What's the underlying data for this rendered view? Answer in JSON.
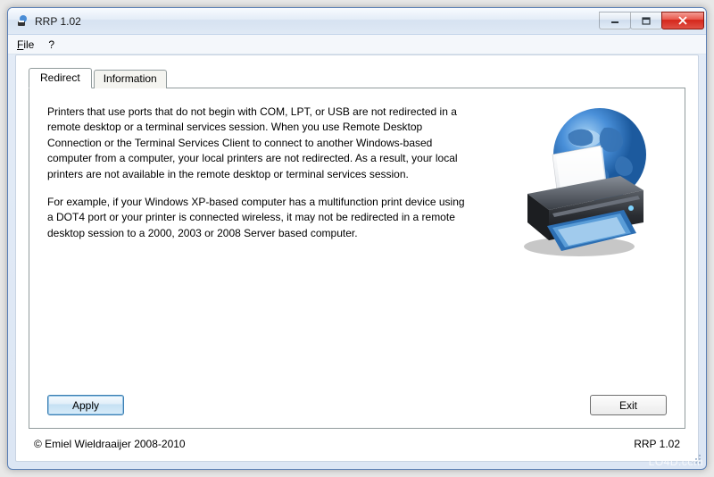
{
  "window": {
    "title": "RRP 1.02"
  },
  "menu": {
    "file": "File",
    "help": "?"
  },
  "tabs": {
    "redirect": "Redirect",
    "information": "Information"
  },
  "content": {
    "para1": "Printers that use ports that do not begin with COM, LPT, or USB are not redirected  in a remote desktop or a terminal services session. When you use Remote Desktop Connection or the Terminal Services Client to connect to another Windows-based computer from a computer, your local printers are not redirected. As a result, your local printers are not available in the remote desktop or terminal services session.",
    "para2": "For example, if your Windows XP-based computer has a multifunction print device using a DOT4 port or your printer is connected wireless, it may not be redirected in a remote desktop session to a 2000, 2003 or 2008 Server based computer."
  },
  "buttons": {
    "apply": "Apply",
    "exit": "Exit"
  },
  "footer": {
    "copyright": "© Emiel Wieldraaijer 2008-2010",
    "version": "RRP 1.02"
  },
  "watermark": "LO4D.com"
}
